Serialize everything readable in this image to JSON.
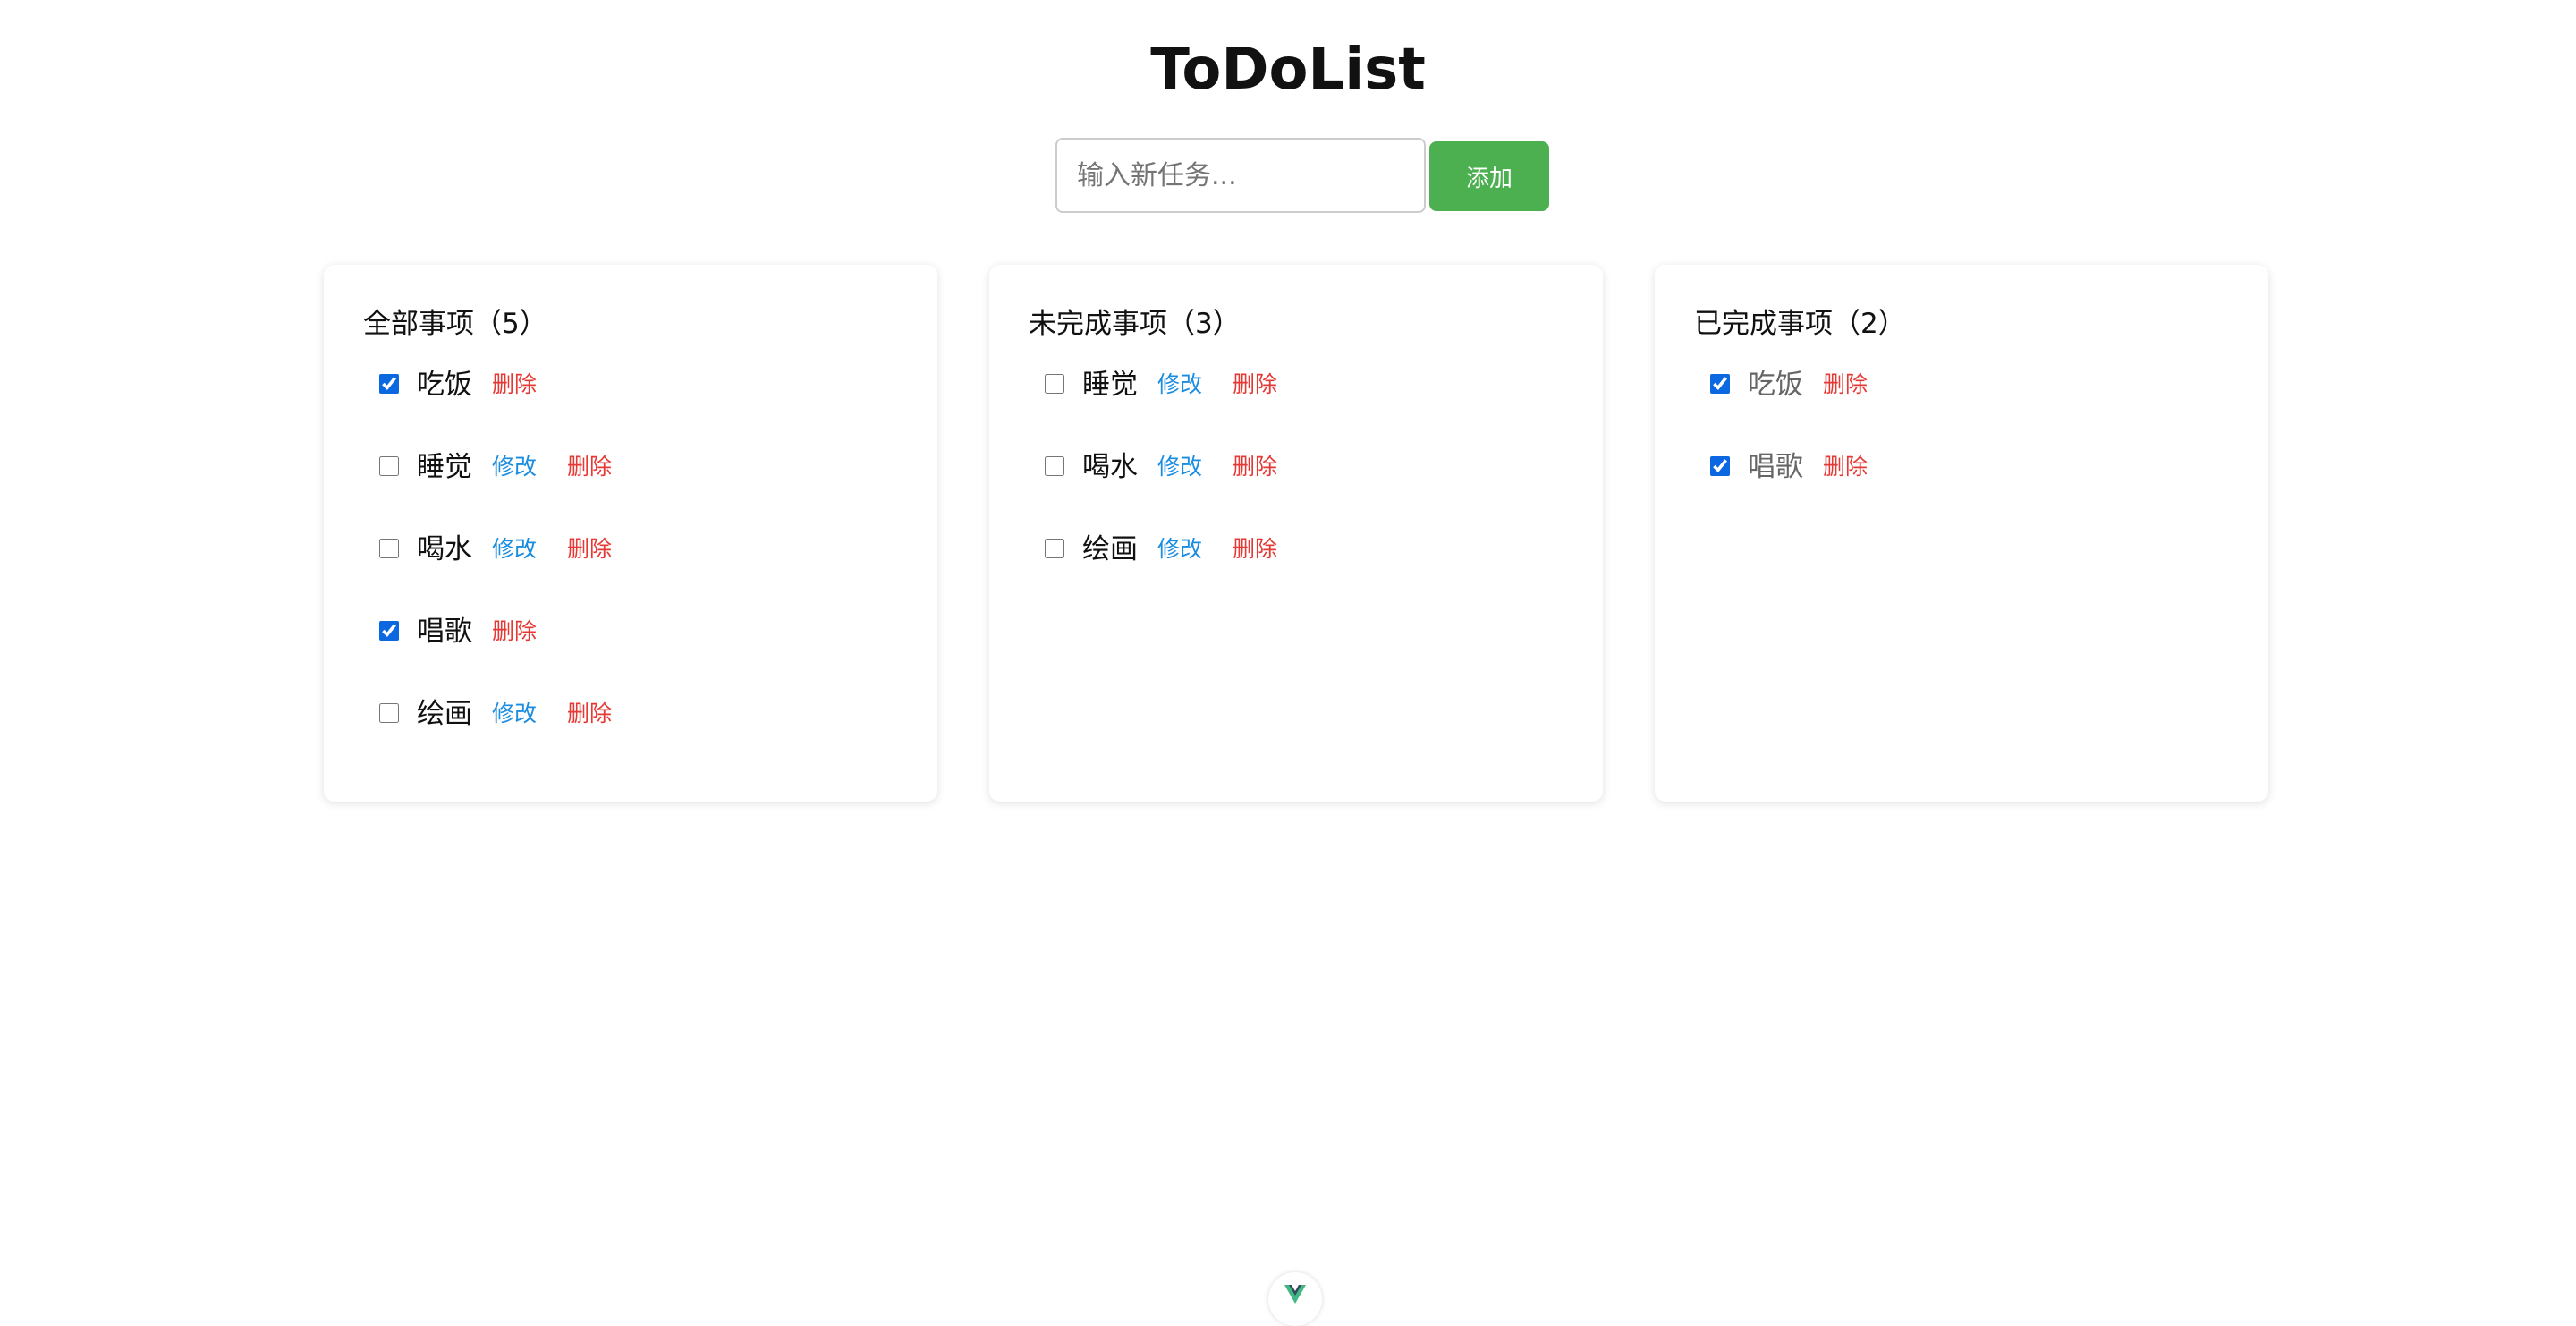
{
  "header": {
    "title": "ToDoList"
  },
  "add_bar": {
    "placeholder": "输入新任务...",
    "value": "",
    "add_label": "添加"
  },
  "panels": [
    {
      "title": "全部事项（5）",
      "items": [
        {
          "text": "吃饭",
          "checked": true,
          "edit_label": "",
          "delete_label": "删除"
        },
        {
          "text": "睡觉",
          "checked": false,
          "edit_label": "修改",
          "delete_label": "删除"
        },
        {
          "text": "喝水",
          "checked": false,
          "edit_label": "修改",
          "delete_label": "删除"
        },
        {
          "text": "唱歌",
          "checked": true,
          "edit_label": "",
          "delete_label": "删除"
        },
        {
          "text": "绘画",
          "checked": false,
          "edit_label": "修改",
          "delete_label": "删除"
        }
      ]
    },
    {
      "title": "未完成事项（3）",
      "items": [
        {
          "text": "睡觉",
          "checked": false,
          "edit_label": "修改",
          "delete_label": "删除"
        },
        {
          "text": "喝水",
          "checked": false,
          "edit_label": "修改",
          "delete_label": "删除"
        },
        {
          "text": "绘画",
          "checked": false,
          "edit_label": "修改",
          "delete_label": "删除"
        }
      ]
    },
    {
      "title": "已完成事项（2）",
      "items": [
        {
          "text": "吃饭",
          "checked": true,
          "edit_label": "",
          "delete_label": "删除"
        },
        {
          "text": "唱歌",
          "checked": true,
          "edit_label": "",
          "delete_label": "删除"
        }
      ]
    }
  ],
  "colors": {
    "add_button": "#4caf50",
    "edit_link": "#1a8de0",
    "delete_link": "#e53935",
    "checkbox": "#0b68e0"
  },
  "icons": {
    "devtools_toggle": "vue-logo-icon"
  }
}
